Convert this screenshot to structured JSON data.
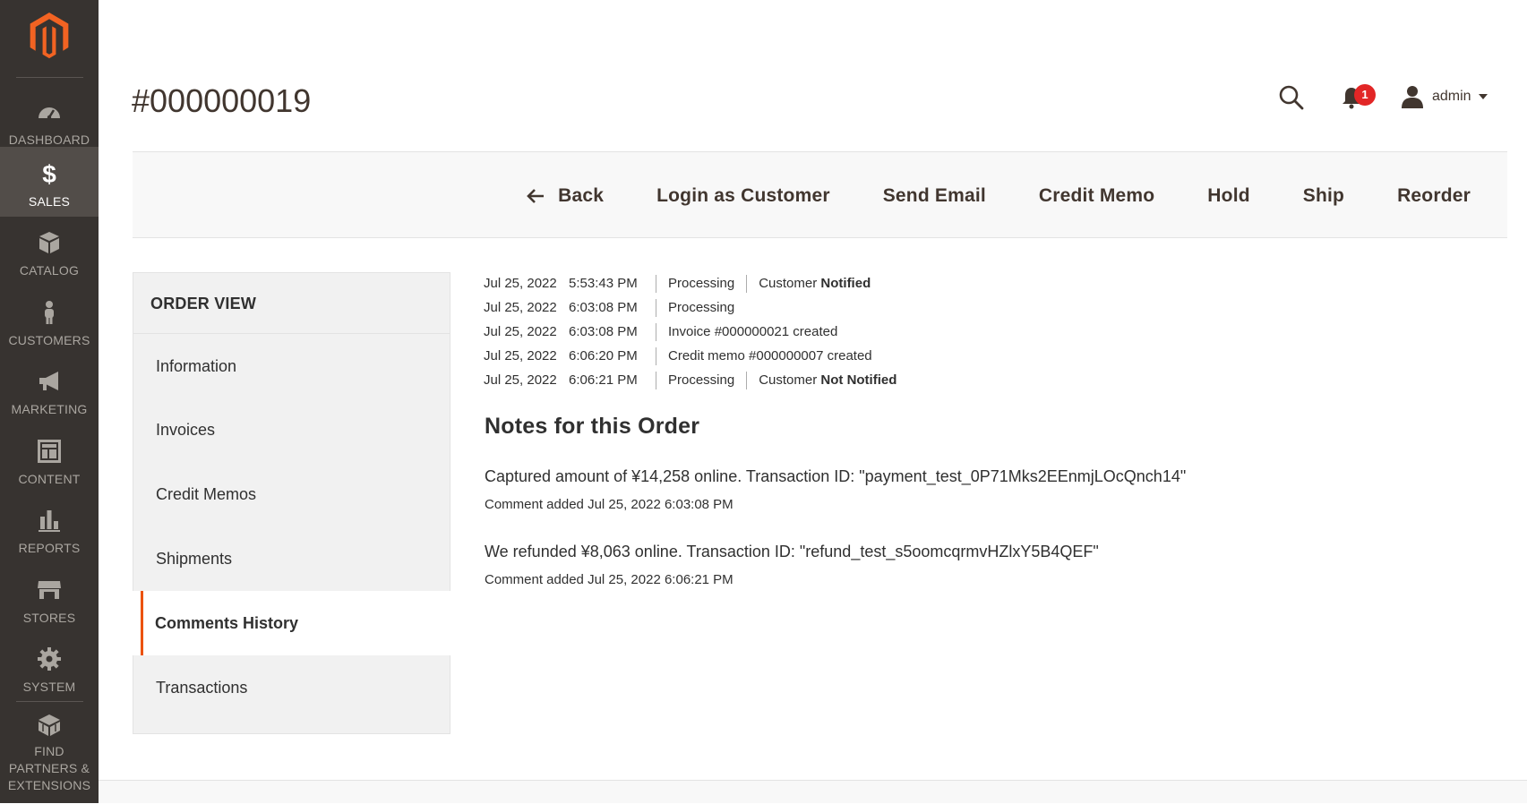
{
  "sidebar": {
    "items": [
      {
        "label": "DASHBOARD",
        "icon": "dashboard-icon"
      },
      {
        "label": "SALES",
        "icon": "dollar-icon"
      },
      {
        "label": "CATALOG",
        "icon": "box-icon"
      },
      {
        "label": "CUSTOMERS",
        "icon": "person-icon"
      },
      {
        "label": "MARKETING",
        "icon": "megaphone-icon"
      },
      {
        "label": "CONTENT",
        "icon": "layout-icon"
      },
      {
        "label": "REPORTS",
        "icon": "bar-chart-icon"
      },
      {
        "label": "STORES",
        "icon": "store-icon"
      },
      {
        "label": "SYSTEM",
        "icon": "gear-icon"
      },
      {
        "label": "FIND PARTNERS & EXTENSIONS",
        "icon": "blocks-icon"
      }
    ],
    "active_color": "#524d49"
  },
  "header": {
    "title": "#000000019",
    "notification_count": "1",
    "user_name": "admin"
  },
  "actions": {
    "back": "Back",
    "login_as_customer": "Login as Customer",
    "send_email": "Send Email",
    "credit_memo": "Credit Memo",
    "hold": "Hold",
    "ship": "Ship",
    "reorder": "Reorder"
  },
  "tabs": {
    "heading": "ORDER VIEW",
    "items": [
      "Information",
      "Invoices",
      "Credit Memos",
      "Shipments",
      "Comments History",
      "Transactions"
    ],
    "active": "Comments History",
    "accent_color": "#eb5202"
  },
  "history": [
    {
      "date": "Jul 25, 2022",
      "time": "5:53:43 PM",
      "status": "Processing",
      "notify_prefix": "Customer",
      "notify_state": "Notified"
    },
    {
      "date": "Jul 25, 2022",
      "time": "6:03:08 PM",
      "status": "Processing"
    },
    {
      "date": "Jul 25, 2022",
      "time": "6:03:08 PM",
      "status": "Invoice #000000021 created"
    },
    {
      "date": "Jul 25, 2022",
      "time": "6:06:20 PM",
      "status": "Credit memo #000000007 created"
    },
    {
      "date": "Jul 25, 2022",
      "time": "6:06:21 PM",
      "status": "Processing",
      "notify_prefix": "Customer",
      "notify_state": "Not Notified"
    }
  ],
  "notes": {
    "title": "Notes for this Order",
    "items": [
      {
        "text": "Captured amount of ¥14,258 online. Transaction ID: \"payment_test_0P71Mks2EEnmjLOcQnch14\"",
        "meta": "Comment added Jul 25, 2022 6:03:08 PM"
      },
      {
        "text": "We refunded ¥8,063 online. Transaction ID: \"refund_test_s5oomcqrmvHZlxY5B4QEF\"",
        "meta": "Comment added Jul 25, 2022 6:06:21 PM"
      }
    ]
  }
}
